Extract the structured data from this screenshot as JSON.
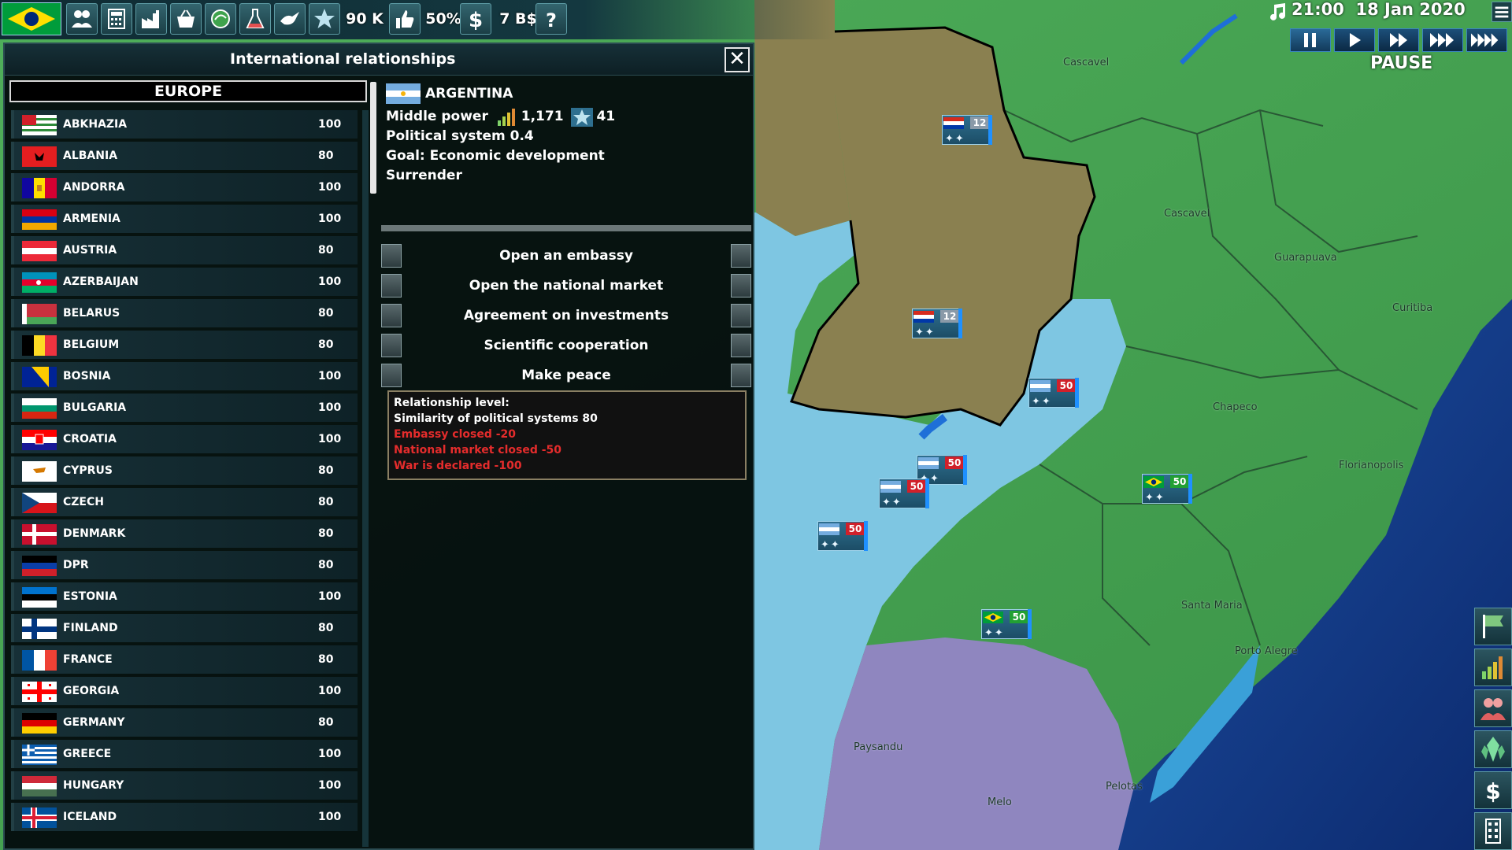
{
  "topbar": {
    "military_value": "90 K",
    "approval": "50%",
    "money": "7 B$"
  },
  "clock": {
    "time": "21:00",
    "date": "18 Jan 2020",
    "status": "PAUSE"
  },
  "panel": {
    "title": "International relationships",
    "close_label": "✕",
    "region": "EUROPE",
    "countries": [
      {
        "name": "ABKHAZIA",
        "value": "100"
      },
      {
        "name": "ALBANIA",
        "value": "80"
      },
      {
        "name": "ANDORRA",
        "value": "100"
      },
      {
        "name": "ARMENIA",
        "value": "100"
      },
      {
        "name": "AUSTRIA",
        "value": "80"
      },
      {
        "name": "AZERBAIJAN",
        "value": "100"
      },
      {
        "name": "BELARUS",
        "value": "80"
      },
      {
        "name": "BELGIUM",
        "value": "80"
      },
      {
        "name": "BOSNIA",
        "value": "100"
      },
      {
        "name": "BULGARIA",
        "value": "100"
      },
      {
        "name": "CROATIA",
        "value": "100"
      },
      {
        "name": "CYPRUS",
        "value": "80"
      },
      {
        "name": "CZECH",
        "value": "80"
      },
      {
        "name": "DENMARK",
        "value": "80"
      },
      {
        "name": "DPR",
        "value": "80"
      },
      {
        "name": "ESTONIA",
        "value": "100"
      },
      {
        "name": "FINLAND",
        "value": "80"
      },
      {
        "name": "FRANCE",
        "value": "80"
      },
      {
        "name": "GEORGIA",
        "value": "100"
      },
      {
        "name": "GERMANY",
        "value": "80"
      },
      {
        "name": "GREECE",
        "value": "100"
      },
      {
        "name": "HUNGARY",
        "value": "100"
      },
      {
        "name": "ICELAND",
        "value": "100"
      }
    ],
    "detail": {
      "country": "ARGENTINA",
      "power_class": "Middle power",
      "power_value": "1,171",
      "rank_value": "41",
      "political_system": "Political system 0.4",
      "goal": "Goal: Economic development",
      "status": "Surrender",
      "actions": [
        "Open an embassy",
        "Open the national market",
        "Agreement on investments",
        "Scientific cooperation",
        "Make peace"
      ],
      "relationship": {
        "header": "Relationship level:",
        "positive": [
          "Similarity of political systems 80"
        ],
        "negative": [
          "Embassy closed -20",
          "National market closed -50",
          "War is declared -100"
        ]
      }
    }
  },
  "map": {
    "cities": [
      "Cascavel",
      "Cascavel",
      "Guarapuava",
      "Curitiba",
      "Chapeco",
      "Florianopolis",
      "Santa Maria",
      "Porto Alegre",
      "Paysandu",
      "Melo",
      "Pelotas"
    ],
    "units": [
      {
        "count": "12",
        "color": "#8a9aa8"
      },
      {
        "count": "12",
        "color": "#8a9aa8"
      },
      {
        "count": "50",
        "color": "#d0202a"
      },
      {
        "count": "50",
        "color": "#d0202a"
      },
      {
        "count": "50",
        "color": "#d0202a"
      },
      {
        "count": "50",
        "color": "#d0202a"
      },
      {
        "count": "50",
        "color": "#22a033"
      },
      {
        "count": "50",
        "color": "#22a033"
      }
    ]
  }
}
